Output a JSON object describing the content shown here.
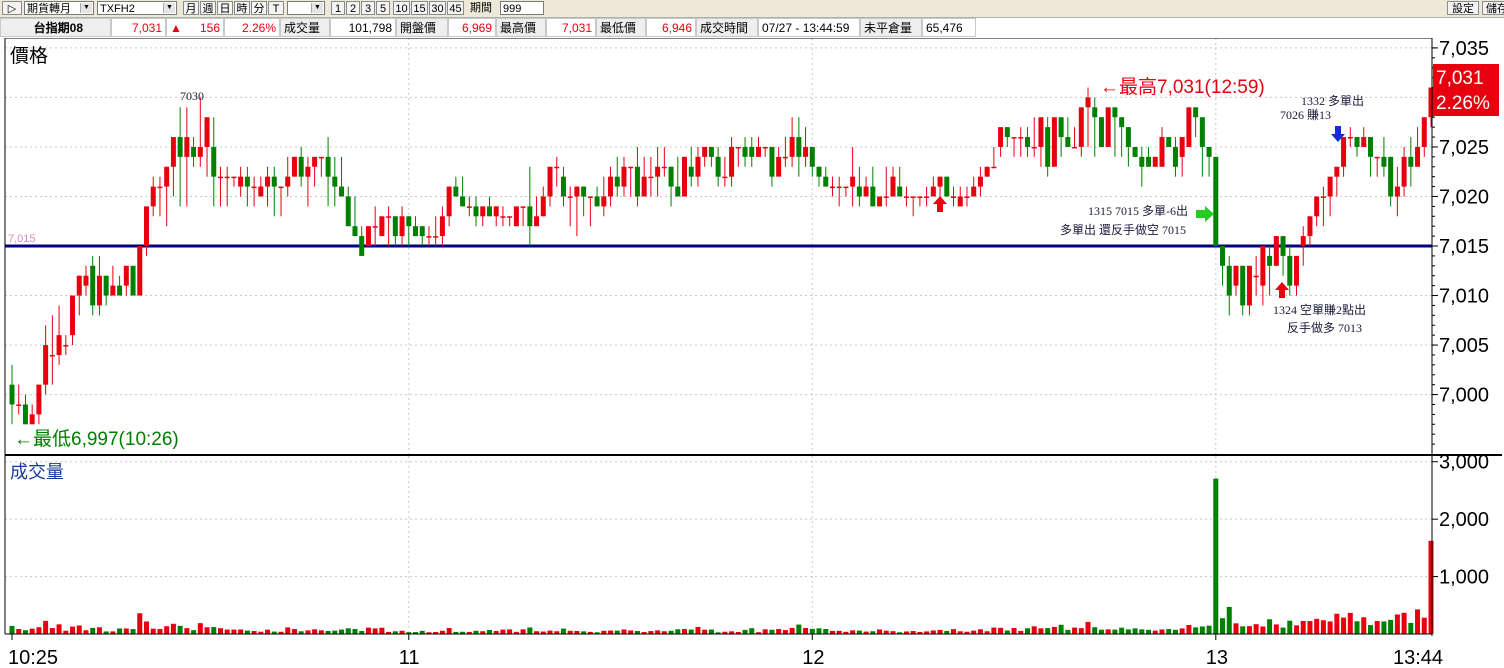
{
  "toolbar": {
    "type_combo": "期貨轉月",
    "symbol_combo": "TXFH2",
    "period_buttons": [
      "月",
      "週",
      "日",
      "時",
      "分",
      "T"
    ],
    "minute_buttons": [
      "1",
      "2",
      "3",
      "5",
      "10",
      "15",
      "30",
      "45"
    ],
    "period_label": "期間",
    "period_value": "999",
    "settings_label": "設定",
    "save_label": "儲存"
  },
  "quote": {
    "name": "台指期08",
    "price": "7,031",
    "change": "156",
    "change_pct": "2.26%",
    "volume_label": "成交量",
    "volume": "101,798",
    "open_label": "開盤價",
    "open": "6,969",
    "high_label": "最高價",
    "high": "7,031",
    "low_label": "最低價",
    "low": "6,946",
    "time_label": "成交時間",
    "time": "07/27 - 13:44:59",
    "oi_label": "未平倉量",
    "oi": "65,476",
    "colors": {
      "up": "#e8000f",
      "down": "#008000",
      "neutral": "#000000"
    }
  },
  "chart_data": {
    "type": "candlestick",
    "price_panel_title": "價格",
    "volume_panel_title": "成交量",
    "price_ylim": [
      6994,
      7036
    ],
    "price_ticks": [
      "7,000",
      "7,005",
      "7,010",
      "7,015",
      "7,020",
      "7,025",
      "7,030",
      "7,035"
    ],
    "volume_ylim": [
      0,
      3100
    ],
    "volume_ticks": [
      "1,000",
      "2,000",
      "3,000"
    ],
    "time_ticks": [
      "10:25",
      "11",
      "12",
      "13",
      "13:44"
    ],
    "reference_line": {
      "value": 7015,
      "label": "7,015",
      "color": "#000080"
    },
    "last_price": "7,031",
    "last_change_pct": "2.26%",
    "annotations": {
      "high": "←最高7,031(12:59)",
      "low": "←最低6,997(10:26)",
      "peak_label": "7030",
      "note_a1": "1315  7015 多單-6出",
      "note_a2": "多單出  還反手做空 7015",
      "note_b1": "1332  多單出",
      "note_b2": "7026  賺13",
      "note_c1": "1324  空單賺2點出",
      "note_c2": "反手做多 7013"
    },
    "colors": {
      "up": "#e8000f",
      "down": "#008000",
      "grid": "#c8c8c8"
    },
    "candles": [
      [
        7001,
        6999,
        7003,
        6997,
        141
      ],
      [
        6999,
        6999,
        7001,
        6998,
        87
      ],
      [
        6999,
        6997,
        7000,
        6997,
        66
      ],
      [
        6997,
        6998,
        6999,
        6997,
        93
      ],
      [
        6998,
        7001,
        7001,
        6997,
        119
      ],
      [
        7001,
        7005,
        7007,
        7000,
        229
      ],
      [
        7004,
        7004,
        7008,
        7001,
        103
      ],
      [
        7004,
        7006,
        7009,
        7003,
        168
      ],
      [
        7005,
        7005,
        7006,
        7004,
        57
      ],
      [
        7006,
        7010,
        7010,
        7005,
        129
      ],
      [
        7010,
        7012,
        7012,
        7008,
        148
      ],
      [
        7011,
        7012,
        7013,
        7010,
        66
      ],
      [
        7013,
        7009,
        7014,
        7008,
        105
      ],
      [
        7009,
        7012,
        7014,
        7008,
        117
      ],
      [
        7012,
        7010,
        7012,
        7009,
        45
      ],
      [
        7010,
        7011,
        7013,
        7010,
        45
      ],
      [
        7011,
        7010,
        7012,
        7010,
        96
      ],
      [
        7011,
        7013,
        7013,
        7010,
        96
      ],
      [
        7013,
        7010,
        7013,
        7010,
        86
      ],
      [
        7010,
        7015,
        7015,
        7010,
        361
      ],
      [
        7015,
        7019,
        7019,
        7014,
        218
      ],
      [
        7019,
        7021,
        7022,
        7018,
        93
      ],
      [
        7021,
        7021,
        7022,
        7018,
        87
      ],
      [
        7021,
        7023,
        7023,
        7017,
        135
      ],
      [
        7023,
        7026,
        7026,
        7020,
        178
      ],
      [
        7026,
        7024,
        7029,
        7019,
        142
      ],
      [
        7024,
        7026,
        7029,
        7019,
        102
      ],
      [
        7025,
        7024,
        7026,
        7023,
        67
      ],
      [
        7024,
        7025,
        7030,
        7023,
        189
      ],
      [
        7025,
        7028,
        7028,
        7022,
        118
      ],
      [
        7025,
        7022,
        7028,
        7019,
        121
      ],
      [
        7022,
        7022,
        7023,
        7019,
        101
      ],
      [
        7022,
        7022,
        7023,
        7019,
        77
      ],
      [
        7022,
        7022,
        7022,
        7021,
        77
      ],
      [
        7021,
        7022,
        7023,
        7020,
        79
      ],
      [
        7022,
        7021,
        7023,
        7019,
        59
      ],
      [
        7021,
        7021,
        7022,
        7019,
        52
      ],
      [
        7020,
        7021,
        7022,
        7020,
        40
      ],
      [
        7021,
        7022,
        7023,
        7019,
        75
      ],
      [
        7022,
        7021,
        7023,
        7018,
        42
      ],
      [
        7021,
        7021,
        7021,
        7018,
        39
      ],
      [
        7021,
        7022,
        7024,
        7020,
        115
      ],
      [
        7022,
        7024,
        7024,
        7022,
        86
      ],
      [
        7024,
        7022,
        7025,
        7021,
        47
      ],
      [
        7022,
        7023,
        7024,
        7019,
        64
      ],
      [
        7023,
        7024,
        7024,
        7021,
        82
      ],
      [
        7024,
        7024,
        7024,
        7022,
        64
      ],
      [
        7024,
        7022,
        7026,
        7019,
        52
      ],
      [
        7022,
        7021,
        7024,
        7019,
        59
      ],
      [
        7021,
        7020,
        7024,
        7020,
        77
      ],
      [
        7020,
        7017,
        7021,
        7017,
        99
      ],
      [
        7017,
        7016,
        7020,
        7016,
        87
      ],
      [
        7016,
        7014,
        7017,
        7014,
        52
      ],
      [
        7015,
        7017,
        7017,
        7015,
        111
      ],
      [
        7017,
        7017,
        7019,
        7015,
        97
      ],
      [
        7016,
        7018,
        7018,
        7016,
        109
      ],
      [
        7018,
        7018,
        7019,
        7015,
        37
      ],
      [
        7018,
        7016,
        7018,
        7015,
        47
      ],
      [
        7016,
        7018,
        7019,
        7015,
        56
      ],
      [
        7018,
        7017,
        7018,
        7015,
        32
      ],
      [
        7017,
        7016,
        7018,
        7016,
        33
      ],
      [
        7017,
        7016,
        7017,
        7015,
        55
      ],
      [
        7016,
        7016,
        7017,
        7015,
        30
      ],
      [
        7016,
        7016,
        7018,
        7015,
        35
      ],
      [
        7016,
        7018,
        7019,
        7015,
        56
      ],
      [
        7018,
        7021,
        7021,
        7017,
        105
      ],
      [
        7021,
        7020,
        7022,
        7020,
        36
      ],
      [
        7020,
        7019,
        7022,
        7019,
        39
      ],
      [
        7019,
        7019,
        7020,
        7018,
        36
      ],
      [
        7019,
        7018,
        7020,
        7017,
        56
      ],
      [
        7018,
        7019,
        7019,
        7017,
        48
      ],
      [
        7019,
        7018,
        7020,
        7018,
        70
      ],
      [
        7018,
        7019,
        7019,
        7017,
        52
      ],
      [
        7018,
        7018,
        7019,
        7017,
        77
      ],
      [
        7018,
        7018,
        7018,
        7017,
        80
      ],
      [
        7017,
        7019,
        7019,
        7017,
        38
      ],
      [
        7019,
        7019,
        7019,
        7017,
        81
      ],
      [
        7019,
        7017,
        7023,
        7015,
        114
      ],
      [
        7017,
        7018,
        7020,
        7017,
        48
      ],
      [
        7018,
        7020,
        7021,
        7018,
        43
      ],
      [
        7020,
        7023,
        7023,
        7019,
        60
      ],
      [
        7023,
        7023,
        7024,
        7021,
        48
      ],
      [
        7022,
        7020,
        7023,
        7019,
        94
      ],
      [
        7020,
        7020,
        7021,
        7017,
        56
      ],
      [
        7020,
        7021,
        7021,
        7016,
        53
      ],
      [
        7021,
        7020,
        7021,
        7018,
        46
      ],
      [
        7020,
        7020,
        7020,
        7017,
        37
      ],
      [
        7020,
        7019,
        7021,
        7019,
        30
      ],
      [
        7019,
        7020,
        7022,
        7018,
        56
      ],
      [
        7020,
        7022,
        7023,
        7019,
        60
      ],
      [
        7022,
        7021,
        7024,
        7020,
        59
      ],
      [
        7021,
        7023,
        7024,
        7020,
        79
      ],
      [
        7023,
        7023,
        7023,
        7020,
        62
      ],
      [
        7023,
        7020,
        7025,
        7019,
        52
      ],
      [
        7020,
        7022,
        7024,
        7020,
        34
      ],
      [
        7022,
        7022,
        7024,
        7020,
        51
      ],
      [
        7022,
        7023,
        7025,
        7020,
        64
      ],
      [
        7023,
        7023,
        7025,
        7022,
        48
      ],
      [
        7023,
        7021,
        7023,
        7019,
        57
      ],
      [
        7021,
        7020,
        7024,
        7020,
        82
      ],
      [
        7020,
        7024,
        7024,
        7020,
        86
      ],
      [
        7023,
        7022,
        7025,
        7021,
        77
      ],
      [
        7022,
        7024,
        7025,
        7021,
        123
      ],
      [
        7024,
        7025,
        7025,
        7023,
        75
      ],
      [
        7025,
        7024,
        7025,
        7023,
        78
      ],
      [
        7024,
        7022,
        7025,
        7021,
        29
      ],
      [
        7022,
        7022,
        7024,
        7021,
        40
      ],
      [
        7022,
        7025,
        7026,
        7021,
        46
      ],
      [
        7025,
        7025,
        7025,
        7023,
        35
      ],
      [
        7025,
        7024,
        7026,
        7023,
        72
      ],
      [
        7025,
        7024,
        7026,
        7023,
        101
      ],
      [
        7024,
        7025,
        7026,
        7024,
        31
      ],
      [
        7025,
        7025,
        7025,
        7024,
        82
      ],
      [
        7025,
        7022,
        7025,
        7021,
        74
      ],
      [
        7022,
        7024,
        7025,
        7024,
        86
      ],
      [
        7024,
        7024,
        7026,
        7023,
        68
      ],
      [
        7024,
        7026,
        7028,
        7023,
        106
      ],
      [
        7026,
        7024,
        7028,
        7022,
        164
      ],
      [
        7024,
        7025,
        7027,
        7023,
        104
      ],
      [
        7025,
        7023,
        7024,
        7022,
        90
      ],
      [
        7023,
        7022,
        7023,
        7021,
        99
      ],
      [
        7022,
        7021,
        7023,
        7021,
        87
      ],
      [
        7021,
        7021,
        7022,
        7020,
        53
      ],
      [
        7021,
        7021,
        7022,
        7019,
        55
      ],
      [
        7021,
        7021,
        7021,
        7020,
        38
      ],
      [
        7021,
        7022,
        7025,
        7019,
        64
      ],
      [
        7021,
        7020,
        7023,
        7019,
        60
      ],
      [
        7020,
        7021,
        7022,
        7020,
        42
      ],
      [
        7021,
        7019,
        7023,
        7019,
        48
      ],
      [
        7019,
        7020,
        7020,
        7019,
        79
      ],
      [
        7020,
        7020,
        7023,
        7019,
        57
      ],
      [
        7020,
        7022,
        7023,
        7020,
        49
      ],
      [
        7021,
        7020,
        7023,
        7020,
        30
      ],
      [
        7020,
        7020,
        7021,
        7019,
        44
      ],
      [
        7020,
        7020,
        7020,
        7018,
        52
      ],
      [
        7020,
        7020,
        7020,
        7019,
        36
      ],
      [
        7020,
        7020,
        7021,
        7019,
        45
      ],
      [
        7020,
        7021,
        7022,
        7020,
        62
      ],
      [
        7021,
        7022,
        7022,
        7020,
        72
      ],
      [
        7022,
        7020,
        7022,
        7020,
        54
      ],
      [
        7020,
        7020,
        7021,
        7019,
        85
      ],
      [
        7019,
        7020,
        7021,
        7019,
        47
      ],
      [
        7020,
        7020,
        7021,
        7019,
        39
      ],
      [
        7020,
        7021,
        7022,
        7020,
        59
      ],
      [
        7021,
        7022,
        7023,
        7020,
        82
      ],
      [
        7022,
        7023,
        7023,
        7022,
        48
      ],
      [
        7023,
        7023,
        7025,
        7023,
        112
      ],
      [
        7025,
        7027,
        7027,
        7024,
        107
      ],
      [
        7027,
        7026,
        7027,
        7025,
        61
      ],
      [
        7026,
        7026,
        7026,
        7024,
        105
      ],
      [
        7026,
        7026,
        7027,
        7024,
        53
      ],
      [
        7026,
        7025,
        7027,
        7024,
        99
      ],
      [
        7025,
        7025,
        7028,
        7024,
        134
      ],
      [
        7025,
        7028,
        7028,
        7023,
        99
      ],
      [
        7027,
        7023,
        7028,
        7022,
        103
      ],
      [
        7023,
        7028,
        7028,
        7025,
        124
      ],
      [
        7028,
        7026,
        7028,
        7024,
        161
      ],
      [
        7026,
        7025,
        7028,
        7025,
        72
      ],
      [
        7025,
        7025,
        7027,
        7025,
        111
      ],
      [
        7025,
        7029,
        7029,
        7024,
        102
      ],
      [
        7029,
        7030,
        7031,
        7025,
        211
      ],
      [
        7029,
        7028,
        7030,
        7024,
        118
      ],
      [
        7028,
        7025,
        7028,
        7025,
        75
      ],
      [
        7025,
        7029,
        7029,
        7025,
        81
      ],
      [
        7029,
        7028,
        7029,
        7024,
        76
      ],
      [
        7028,
        7027,
        7028,
        7024,
        110
      ],
      [
        7027,
        7025,
        7027,
        7023,
        80
      ],
      [
        7025,
        7024,
        7025,
        7024,
        98
      ],
      [
        7024,
        7023,
        7025,
        7021,
        81
      ],
      [
        7024,
        7023,
        7025,
        7023,
        73
      ],
      [
        7023,
        7024,
        7024,
        7023,
        59
      ],
      [
        7023,
        7026,
        7027,
        7023,
        79
      ],
      [
        7026,
        7025,
        7026,
        7025,
        86
      ],
      [
        7025,
        7023,
        7026,
        7022,
        73
      ],
      [
        7024,
        7026,
        7026,
        7022,
        97
      ],
      [
        7025,
        7029,
        7029,
        7025,
        157
      ],
      [
        7029,
        7028,
        7029,
        7026,
        115
      ],
      [
        7028,
        7025,
        7028,
        7022,
        131
      ],
      [
        7025,
        7024,
        7025,
        7022,
        145
      ],
      [
        7024,
        7015,
        7024,
        7015,
        2707
      ],
      [
        7015,
        7013,
        7015,
        7011,
        275
      ],
      [
        7013,
        7010,
        7014,
        7008,
        472
      ],
      [
        7011,
        7013,
        7013,
        7010,
        186
      ],
      [
        7013,
        7009,
        7013,
        7008,
        134
      ],
      [
        7009,
        7013,
        7013,
        7008,
        137
      ],
      [
        7012,
        7012,
        7014,
        7010,
        171
      ],
      [
        7011,
        7015,
        7015,
        7009,
        131
      ],
      [
        7014,
        7013,
        7015,
        7010,
        256
      ],
      [
        7013,
        7016,
        7016,
        7013,
        167
      ],
      [
        7016,
        7014,
        7016,
        7012,
        112
      ],
      [
        7014,
        7011,
        7015,
        7010,
        232
      ],
      [
        7011,
        7014,
        7014,
        7010,
        150
      ],
      [
        7015,
        7016,
        7017,
        7013,
        227
      ],
      [
        7016,
        7018,
        7018,
        7015,
        225
      ],
      [
        7018,
        7020,
        7020,
        7017,
        264
      ],
      [
        7020,
        7020,
        7021,
        7017,
        240
      ],
      [
        7020,
        7022,
        7022,
        7018,
        219
      ],
      [
        7022,
        7023,
        7023,
        7020,
        353
      ],
      [
        7023,
        7026,
        7026,
        7022,
        286
      ],
      [
        7026,
        7026,
        7027,
        7025,
        368
      ],
      [
        7026,
        7025,
        7026,
        7024,
        221
      ],
      [
        7025,
        7026,
        7027,
        7025,
        291
      ],
      [
        7026,
        7024,
        7026,
        7022,
        155
      ],
      [
        7024,
        7024,
        7024,
        7022,
        226
      ],
      [
        7024,
        7023,
        7026,
        7022,
        219
      ],
      [
        7024,
        7020,
        7024,
        7019,
        246
      ],
      [
        7020,
        7021,
        7023,
        7018,
        340
      ],
      [
        7021,
        7024,
        7025,
        7020,
        369
      ],
      [
        7024,
        7023,
        7026,
        7021,
        193
      ],
      [
        7023,
        7025,
        7027,
        7023,
        429
      ],
      [
        7025,
        7028,
        7028,
        7024,
        284
      ],
      [
        7028,
        7031,
        7031,
        7027,
        1622
      ]
    ]
  }
}
